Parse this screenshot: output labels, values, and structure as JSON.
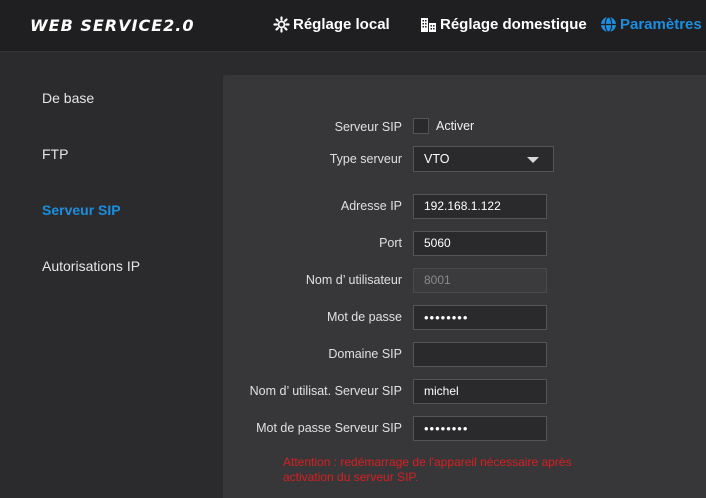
{
  "header": {
    "logo": "WEB SERVICE2.0",
    "nav": [
      {
        "label": "Réglage local",
        "icon": "gear-icon"
      },
      {
        "label": "Réglage domestique",
        "icon": "building-icon"
      },
      {
        "label": "Paramètres r",
        "icon": "globe-icon",
        "active": true
      }
    ]
  },
  "sidebar": {
    "items": [
      {
        "label": "De base"
      },
      {
        "label": "FTP"
      },
      {
        "label": "Serveur SIP",
        "active": true
      },
      {
        "label": "Autorisations IP"
      }
    ]
  },
  "form": {
    "sip_server": {
      "label": "Serveur SIP",
      "checkbox_label": "Activer",
      "checked": false
    },
    "server_type": {
      "label": "Type serveur",
      "value": "VTO"
    },
    "ip_address": {
      "label": "Adresse IP",
      "value": "192.168.1.122"
    },
    "port": {
      "label": "Port",
      "value": "5060"
    },
    "username": {
      "label": "Nom d’ utilisateur",
      "value": "8001"
    },
    "password": {
      "label": "Mot de passe",
      "value": "••••••••"
    },
    "sip_domain": {
      "label": "Domaine SIP",
      "value": ""
    },
    "sip_server_username": {
      "label": "Nom d’ utilisat. Serveur SIP",
      "value": "michel"
    },
    "sip_server_password": {
      "label": "Mot de passe Serveur SIP",
      "value": "••••••••"
    }
  },
  "warning": "Attention : redémarrage de l'appareil nécessaire après activation du serveur SIP.",
  "colors": {
    "accent": "#1a8ee0",
    "warning": "#d62020",
    "panel": "#37373a",
    "background": "#2b2b2e"
  }
}
